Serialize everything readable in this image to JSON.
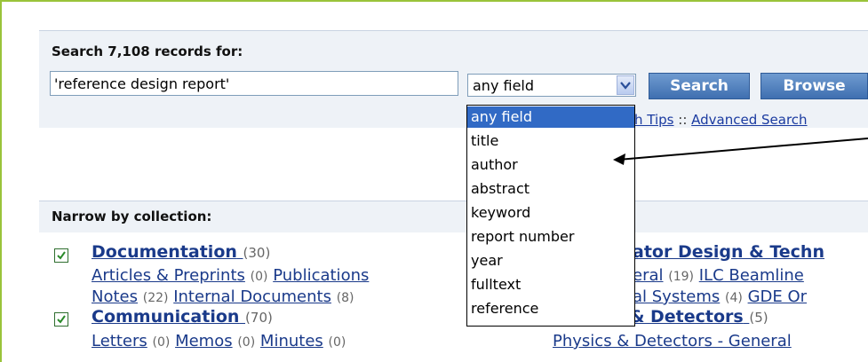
{
  "search": {
    "label": "Search 7,108 records for:",
    "query_value": "'reference design report'",
    "field_selected": "any field",
    "search_button": "Search",
    "browse_button": "Browse",
    "tips_partial": "h Tips",
    "tips_separator": "::",
    "advanced_search": "Advanced Search"
  },
  "field_options": [
    "any field",
    "title",
    "author",
    "abstract",
    "keyword",
    "report number",
    "year",
    "fulltext",
    "reference"
  ],
  "narrow": {
    "label": "Narrow by collection:",
    "collections": [
      {
        "title": "Documentation",
        "count": "(30)",
        "line1": [
          {
            "text": "Articles & Preprints",
            "count": "(0)"
          },
          {
            "text": "Publications",
            "count": ""
          }
        ],
        "line2": [
          {
            "text": "Notes",
            "count": "(22)"
          },
          {
            "text": "Internal Documents",
            "count": "(8)"
          }
        ]
      },
      {
        "title": "Communication",
        "count": "(70)",
        "line1": [
          {
            "text": "Letters",
            "count": "(0)"
          },
          {
            "text": "Memos",
            "count": "(0)"
          },
          {
            "text": "Minutes",
            "count": "(0)"
          }
        ]
      }
    ],
    "right": {
      "title1": "ator Design & Techn",
      "line1a": "eral",
      "line1a_count": "(19)",
      "line1b": "ILC Beamline",
      "line2a": "al Systems",
      "line2a_count": "(4)",
      "line2b": "GDE Or",
      "title2": "Physics & Detectors",
      "title2_count": "(5)",
      "line3": "Physics & Detectors - General"
    }
  },
  "colors": {
    "frame": "#9ac43a",
    "panel": "#eef2f7",
    "link": "#1a3a8a",
    "button": "#4f7fbf",
    "selected": "#316ac5"
  }
}
